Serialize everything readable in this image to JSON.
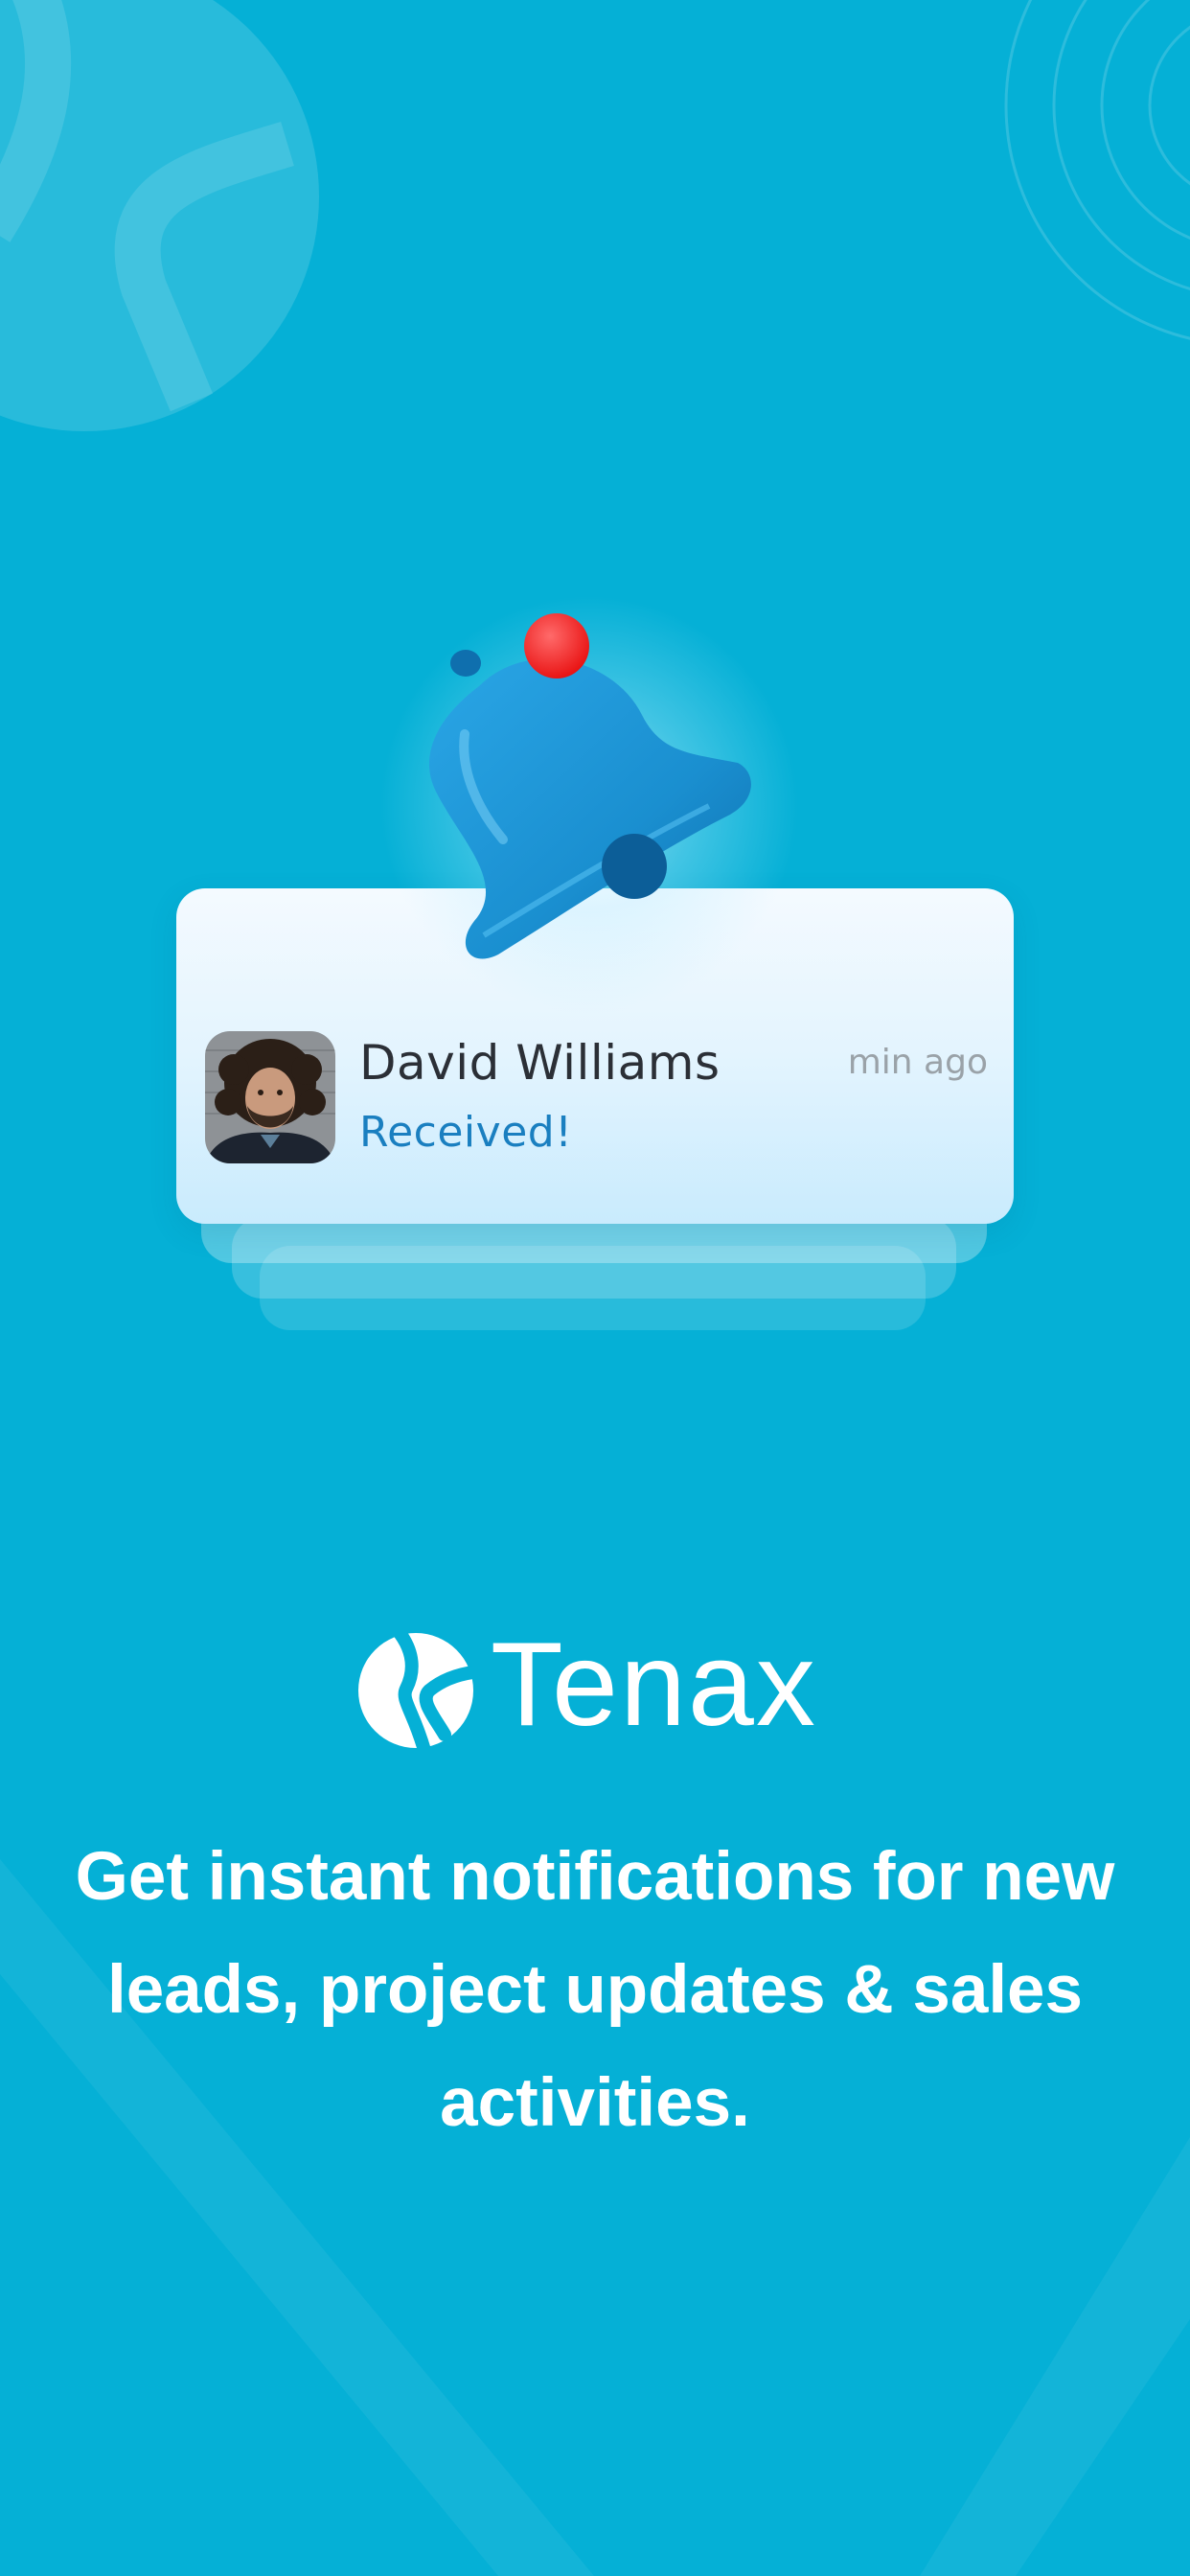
{
  "theme": {
    "background": "#05b0d6",
    "accent": "#1a7fc0",
    "badge": "#ff2a2a",
    "bell": "#1a8fd0"
  },
  "notification": {
    "sender_name": "David Williams",
    "message": "Received!",
    "time_ago": "min ago",
    "icon": "bell-icon"
  },
  "brand": {
    "name": "Tenax",
    "icon": "tenax-logo-icon"
  },
  "tagline": "Get instant notifications for new leads, project updates & sales activities."
}
